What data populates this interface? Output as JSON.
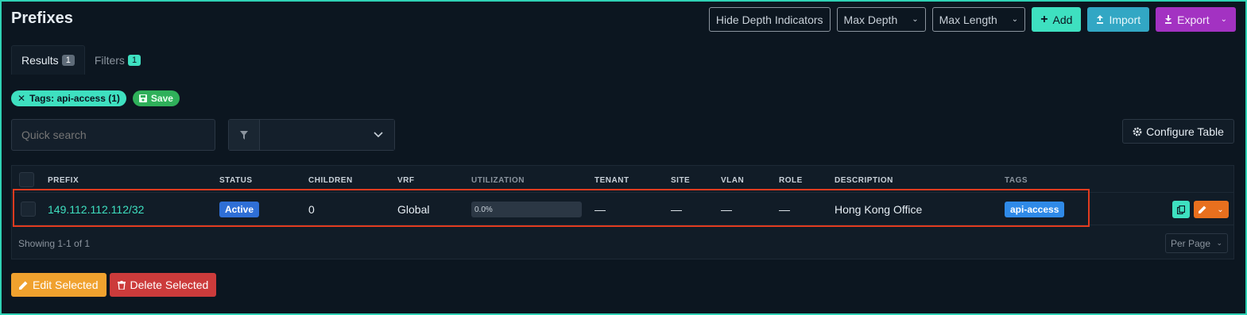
{
  "page": {
    "title": "Prefixes"
  },
  "toolbar": {
    "hide_depth_label": "Hide Depth Indicators",
    "max_depth_label": "Max Depth",
    "max_length_label": "Max Length",
    "add_label": "Add",
    "import_label": "Import",
    "export_label": "Export"
  },
  "tabs": [
    {
      "label": "Results",
      "count": "1"
    },
    {
      "label": "Filters",
      "count": "1"
    }
  ],
  "filters": {
    "active_chip": "Tags: api-access (1)",
    "save_label": "Save"
  },
  "search": {
    "placeholder": "Quick search"
  },
  "config_table_label": "Configure Table",
  "table": {
    "headers": [
      "PREFIX",
      "STATUS",
      "CHILDREN",
      "VRF",
      "UTILIZATION",
      "TENANT",
      "SITE",
      "VLAN",
      "ROLE",
      "DESCRIPTION",
      "TAGS"
    ],
    "rows": [
      {
        "prefix": "149.112.112.112/32",
        "status": "Active",
        "children": "0",
        "vrf": "Global",
        "utilization": "0.0%",
        "tenant": "—",
        "site": "—",
        "vlan": "—",
        "role": "—",
        "description": "Hong Kong Office",
        "tags": "api-access"
      }
    ],
    "footer": "Showing 1-1 of 1",
    "per_page_label": "Per Page"
  },
  "bulk": {
    "edit_selected": "Edit Selected",
    "delete_selected": "Delete Selected"
  },
  "colors": {
    "accent": "#3ee0c0",
    "status_active": "#2f6fd6",
    "highlight": "#e23b1f"
  }
}
